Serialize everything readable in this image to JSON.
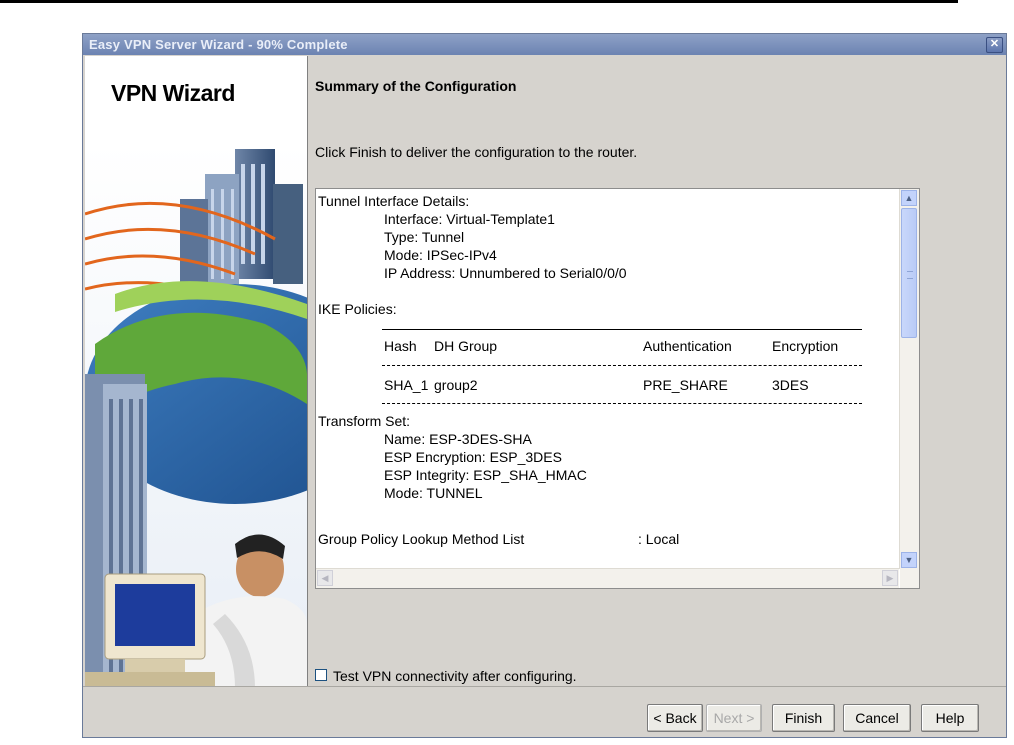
{
  "window": {
    "title": "Easy VPN Server Wizard - 90% Complete",
    "close_glyph": "✕"
  },
  "side": {
    "heading": "VPN Wizard"
  },
  "main": {
    "title": "Summary of the Configuration",
    "instruction": "Click Finish to deliver the configuration to the router."
  },
  "summary": {
    "tunnel_heading": "Tunnel Interface Details:",
    "tunnel_lines": [
      "Interface: Virtual-Template1",
      "Type: Tunnel",
      "Mode: IPSec-IPv4",
      "IP Address: Unnumbered to Serial0/0/0"
    ],
    "ike_heading": "IKE Policies:",
    "ike_columns": [
      "Hash",
      "DH Group",
      "Authentication",
      "Encryption"
    ],
    "ike_row": [
      "SHA_1",
      "group2",
      "PRE_SHARE",
      "3DES"
    ],
    "transform_heading": "Transform Set:",
    "transform_lines": [
      "Name: ESP-3DES-SHA",
      "ESP Encryption: ESP_3DES",
      "ESP Integrity: ESP_SHA_HMAC",
      "Mode: TUNNEL"
    ],
    "group_policy_label": "Group Policy Lookup Method List",
    "group_policy_value": ": Local"
  },
  "options": {
    "test_vpn_label": "Test VPN connectivity after configuring.",
    "test_vpn_checked": false
  },
  "buttons": {
    "back": "< Back",
    "next": "Next >",
    "finish": "Finish",
    "cancel": "Cancel",
    "help": "Help"
  },
  "colors": {
    "titlebar": "#7a8fbe",
    "dialog_bg": "#d6d3ce",
    "scroll_thumb": "#c3d3fb"
  },
  "icons": {
    "close": "close-icon",
    "scroll_up": "chevron-up-icon",
    "scroll_down": "chevron-down-icon",
    "scroll_left": "chevron-left-icon",
    "scroll_right": "chevron-right-icon"
  }
}
